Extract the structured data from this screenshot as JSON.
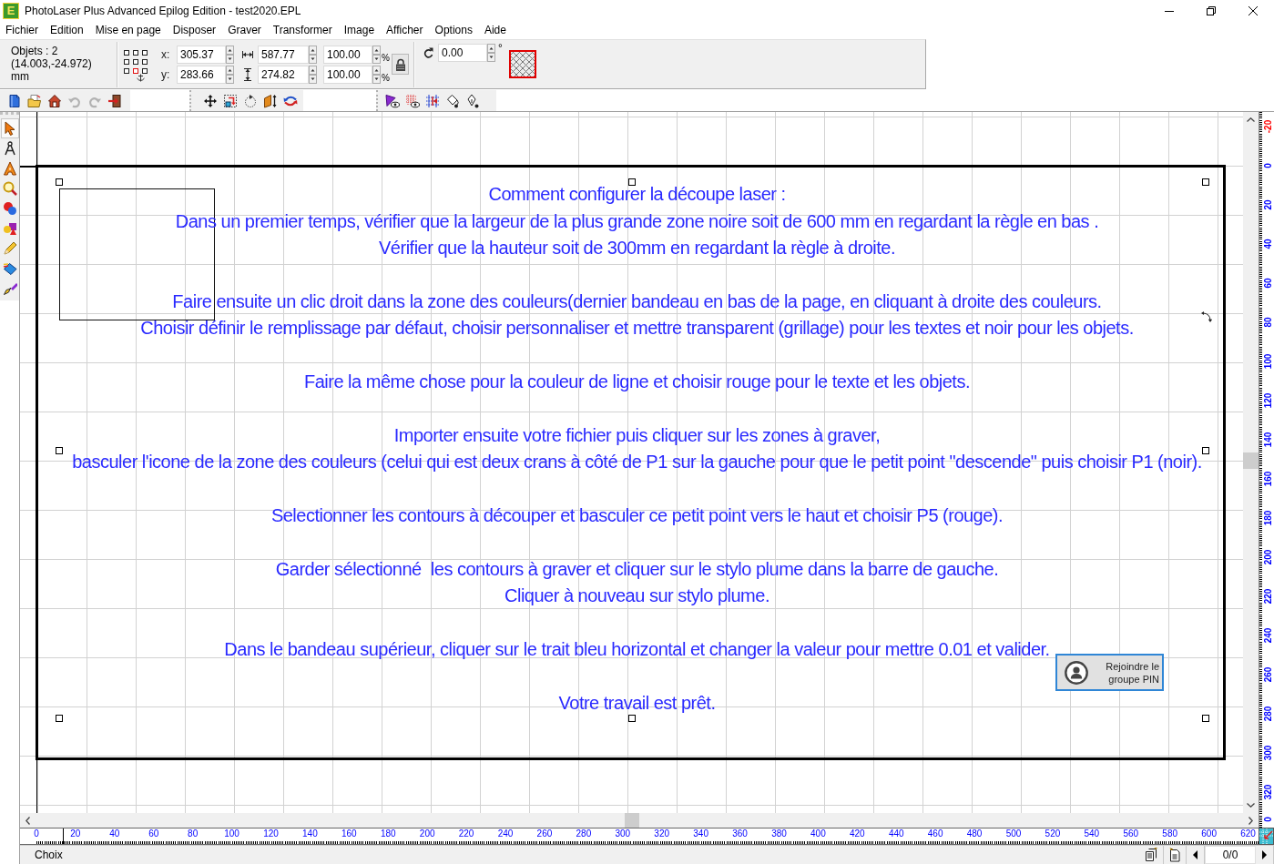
{
  "window": {
    "title": "PhotoLaser Plus Advanced Epilog Edition - test2020.EPL",
    "icon_letter": "E"
  },
  "menu": [
    "Fichier",
    "Edition",
    "Mise en page",
    "Disposer",
    "Graver",
    "Transformer",
    "Image",
    "Afficher",
    "Options",
    "Aide"
  ],
  "properties": {
    "info": [
      "Objets : 2",
      "(14.003,-24.972)",
      "mm"
    ],
    "anchor_points": [
      {
        "selected": false
      },
      {
        "selected": false
      },
      {
        "selected": false
      },
      {
        "selected": false
      },
      {
        "selected": false
      },
      {
        "selected": false
      },
      {
        "selected": false
      },
      {
        "selected": true
      },
      {
        "selected": false
      }
    ],
    "x": {
      "label": "x:",
      "value": "305.37"
    },
    "y": {
      "label": "y:",
      "value": "283.66"
    },
    "width": {
      "value": "587.77"
    },
    "height": {
      "value": "274.82"
    },
    "scale_x": {
      "value": "100.00",
      "unit": "%"
    },
    "scale_y": {
      "value": "100.00",
      "unit": "%"
    },
    "rotation": {
      "value": "0.00",
      "unit": "°"
    }
  },
  "toolbar": {
    "groups": [
      [
        {
          "disabled": false
        },
        {
          "disabled": false
        },
        {
          "disabled": false
        },
        {
          "disabled": true
        },
        {
          "disabled": true
        },
        {
          "disabled": false
        }
      ],
      [
        {
          "disabled": false
        },
        {
          "disabled": false
        },
        {
          "disabled": false
        },
        {
          "disabled": false
        },
        {
          "disabled": false
        }
      ],
      [
        {
          "disabled": false
        },
        {
          "disabled": false
        },
        {
          "disabled": false
        },
        {
          "disabled": false
        },
        {
          "disabled": false
        }
      ]
    ]
  },
  "tools": [
    {
      "selected": true
    },
    {
      "selected": false
    },
    {
      "selected": false
    },
    {
      "selected": false
    },
    {
      "selected": false
    },
    {
      "selected": false
    },
    {
      "selected": false
    },
    {
      "selected": false
    },
    {
      "selected": false
    }
  ],
  "canvas": {
    "paragraphs": [
      [
        "Comment configurer la découpe laser :",
        "Dans un premier temps, vérifier que la largeur de la plus grande zone noire soit de 600 mm en regardant la règle en bas .",
        "Vérifier que la hauteur soit de 300mm en regardant la règle à droite."
      ],
      [
        "Faire ensuite un clic droit dans la zone des couleurs(dernier bandeau en bas de la page, en cliquant à droite des couleurs.",
        "Choisir définir le remplissage par défaut, choisir personnaliser et mettre transparent (grillage) pour les textes et noir pour les objets."
      ],
      [
        "Faire la même chose pour la couleur de ligne et choisir rouge pour le texte et les objets."
      ],
      [
        "Importer ensuite votre fichier puis cliquer sur les zones à graver,",
        "basculer l'icone de la zone des couleurs (celui qui est deux crans à côté de P1 sur la gauche pour que le petit point \"descende\" puis choisir P1 (noir)."
      ],
      [
        "Selectionner les contours à découper et basculer ce petit point vers le haut et choisir P5 (rouge)."
      ],
      [
        "Garder sélectionné  les contours à graver et cliquer sur le stylo plume dans la barre de gauche.",
        "Cliquer à nouveau sur stylo plume."
      ],
      [
        "Dans le bandeau supérieur, cliquer sur le trait bleu horizontal et changer la valeur pour mettre 0.01 et valider."
      ],
      [
        "Votre travail est prêt."
      ]
    ],
    "join_button": {
      "label": "Rejoindre le groupe PIN"
    }
  },
  "right_ruler": {
    "labels": [
      {
        "text": "-20",
        "color": "#ff0000"
      },
      {
        "text": "0",
        "color": "#0000ff"
      },
      {
        "text": "20",
        "color": "#0000ff"
      },
      {
        "text": "40",
        "color": "#0000ff"
      },
      {
        "text": "60",
        "color": "#0000ff"
      },
      {
        "text": "80",
        "color": "#0000ff"
      },
      {
        "text": "100",
        "color": "#0000ff"
      },
      {
        "text": "120",
        "color": "#0000ff"
      },
      {
        "text": "140",
        "color": "#0000ff"
      },
      {
        "text": "160",
        "color": "#0000ff"
      },
      {
        "text": "180",
        "color": "#0000ff"
      },
      {
        "text": "200",
        "color": "#0000ff"
      },
      {
        "text": "220",
        "color": "#0000ff"
      },
      {
        "text": "240",
        "color": "#0000ff"
      },
      {
        "text": "260",
        "color": "#0000ff"
      },
      {
        "text": "280",
        "color": "#0000ff"
      },
      {
        "text": "300",
        "color": "#0000ff"
      },
      {
        "text": "320",
        "color": "#0000ff"
      },
      {
        "text": "0",
        "color": "#0000ff"
      }
    ]
  },
  "bottom_ruler": {
    "labels": [
      "0",
      "20",
      "40",
      "60",
      "80",
      "100",
      "120",
      "140",
      "160",
      "180",
      "200",
      "220",
      "240",
      "260",
      "280",
      "300",
      "320",
      "340",
      "360",
      "380",
      "400",
      "420",
      "440",
      "460",
      "480",
      "500",
      "520",
      "540",
      "560",
      "580",
      "600",
      "620"
    ]
  },
  "status_bar": {
    "text": "Choix",
    "page": "0/0"
  }
}
